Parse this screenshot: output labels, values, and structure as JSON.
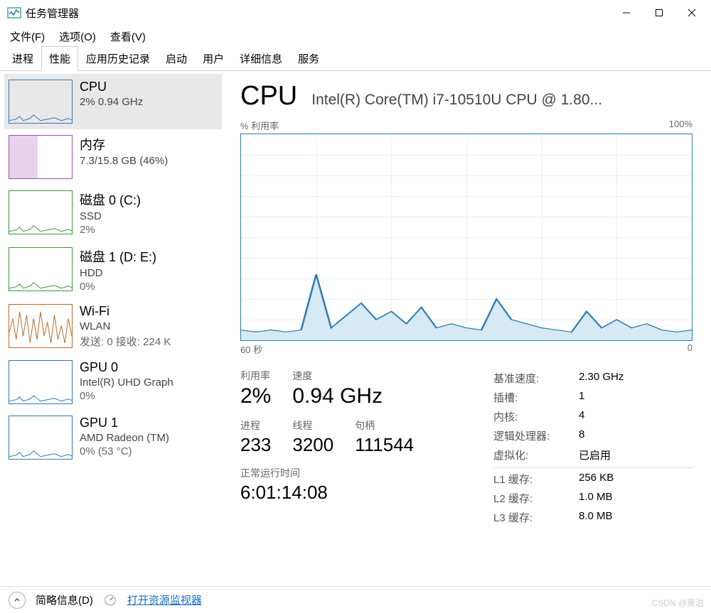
{
  "window": {
    "title": "任务管理器"
  },
  "menu": {
    "file": "文件(F)",
    "options": "选项(O)",
    "view": "查看(V)"
  },
  "tabs": [
    "进程",
    "性能",
    "应用历史记录",
    "启动",
    "用户",
    "详细信息",
    "服务"
  ],
  "active_tab": 1,
  "sidebar": [
    {
      "name": "CPU",
      "sub": "2%  0.94 GHz",
      "sub2": "",
      "color": "#2a7ab0",
      "selected": true
    },
    {
      "name": "内存",
      "sub": "7.3/15.8 GB (46%)",
      "sub2": "",
      "color": "#9b4fb0",
      "selected": false,
      "fill_pct": 46
    },
    {
      "name": "磁盘 0 (C:)",
      "sub": "SSD",
      "sub2": "2%",
      "color": "#3a9a3a",
      "selected": false
    },
    {
      "name": "磁盘 1 (D: E:)",
      "sub": "HDD",
      "sub2": "0%",
      "color": "#3a9a3a",
      "selected": false
    },
    {
      "name": "Wi-Fi",
      "sub": "WLAN",
      "sub2": "发送: 0  接收: 224 K",
      "color": "#b86a2a",
      "selected": false,
      "busy": true
    },
    {
      "name": "GPU 0",
      "sub": "Intel(R) UHD Graph",
      "sub2": "0%",
      "color": "#2a7ab0",
      "selected": false
    },
    {
      "name": "GPU 1",
      "sub": "AMD Radeon (TM)",
      "sub2": "0%  (53 °C)",
      "color": "#2a7ab0",
      "selected": false
    }
  ],
  "main": {
    "title": "CPU",
    "model": "Intel(R) Core(TM) i7-10510U CPU @ 1.80...",
    "chart_top_left": "% 利用率",
    "chart_top_right": "100%",
    "chart_bottom_left": "60 秒",
    "chart_bottom_right": "0",
    "stats": {
      "util_label": "利用率",
      "util": "2%",
      "speed_label": "速度",
      "speed": "0.94 GHz",
      "proc_label": "进程",
      "proc": "233",
      "threads_label": "线程",
      "threads": "3200",
      "handles_label": "句柄",
      "handles": "111544",
      "uptime_label": "正常运行时间",
      "uptime": "6:01:14:08"
    },
    "specs": {
      "base_speed_k": "基准速度:",
      "base_speed_v": "2.30 GHz",
      "sockets_k": "插槽:",
      "sockets_v": "1",
      "cores_k": "内核:",
      "cores_v": "4",
      "lproc_k": "逻辑处理器:",
      "lproc_v": "8",
      "virt_k": "虚拟化:",
      "virt_v": "已启用",
      "l1_k": "L1 缓存:",
      "l1_v": "256 KB",
      "l2_k": "L2 缓存:",
      "l2_v": "1.0 MB",
      "l3_k": "L3 缓存:",
      "l3_v": "8.0 MB"
    }
  },
  "bottom": {
    "less": "简略信息(D)",
    "rm": "打开资源监视器"
  },
  "watermark": "CSDN @萧泊",
  "chart_data": {
    "type": "line",
    "title": "% 利用率",
    "xlabel": "60 秒",
    "ylabel": "",
    "ylim": [
      0,
      100
    ],
    "xlim": [
      60,
      0
    ],
    "x": [
      60,
      58,
      56,
      54,
      52,
      50,
      48,
      46,
      44,
      42,
      40,
      38,
      36,
      34,
      32,
      30,
      28,
      26,
      24,
      22,
      20,
      18,
      16,
      14,
      12,
      10,
      8,
      6,
      4,
      2,
      0
    ],
    "values": [
      5,
      4,
      5,
      4,
      5,
      32,
      6,
      12,
      18,
      10,
      14,
      8,
      16,
      6,
      8,
      6,
      5,
      20,
      10,
      8,
      6,
      5,
      4,
      14,
      6,
      10,
      6,
      8,
      5,
      4,
      5
    ]
  }
}
